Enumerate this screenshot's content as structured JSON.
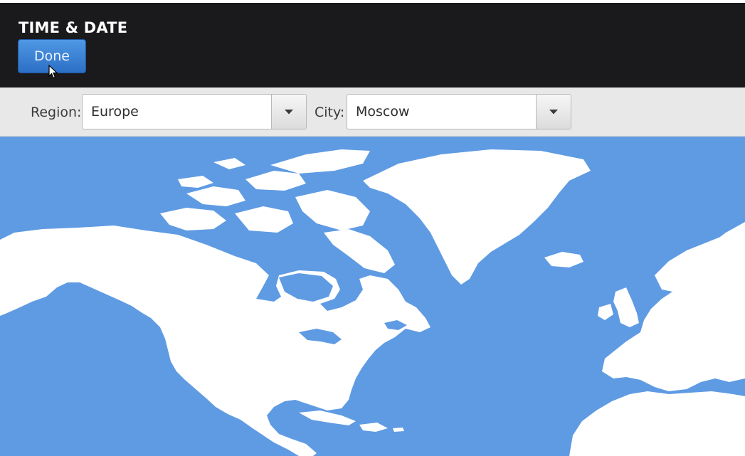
{
  "header": {
    "title": "TIME & DATE",
    "done_label": "Done"
  },
  "toolbar": {
    "region_label": "Region:",
    "region_value": "Europe",
    "city_label": "City:",
    "city_value": "Moscow"
  },
  "map": {
    "ocean_color": "#5f9be3",
    "land_color": "#ffffff"
  },
  "icons": {
    "dropdown": "chevron-down-icon",
    "cursor": "pointer-cursor-icon"
  }
}
